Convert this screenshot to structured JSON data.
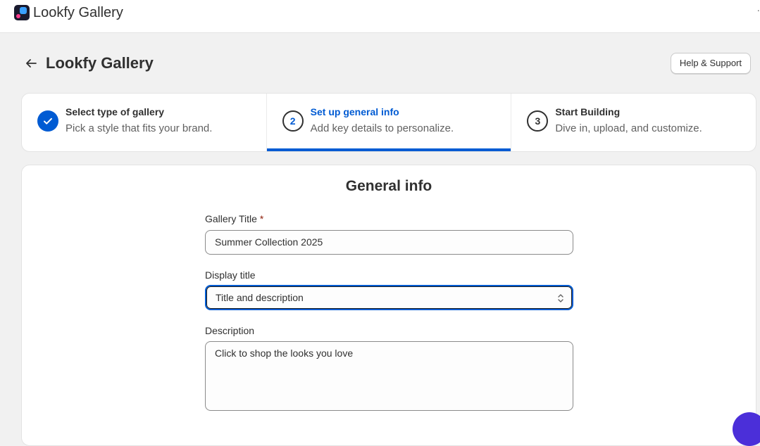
{
  "app": {
    "name": "Lookfy Gallery",
    "more_glyph": "·"
  },
  "header": {
    "title": "Lookfy Gallery",
    "help_label": "Help & Support"
  },
  "steps": [
    {
      "number": "1",
      "title": "Select type of gallery",
      "description": "Pick a style that fits your brand.",
      "status": "done"
    },
    {
      "number": "2",
      "title": "Set up general info",
      "description": "Add key details to personalize.",
      "status": "current"
    },
    {
      "number": "3",
      "title": "Start Building",
      "description": "Dive in, upload, and customize.",
      "status": "todo"
    }
  ],
  "form": {
    "title": "General info",
    "gallery_title": {
      "label": "Gallery Title",
      "required_mark": "*",
      "value": "Summer Collection 2025"
    },
    "display_title": {
      "label": "Display title",
      "value": "Title and description"
    },
    "description": {
      "label": "Description",
      "value": "Click to shop the looks you love"
    }
  },
  "colors": {
    "accent": "#005bd3",
    "required": "#8e1f0b",
    "chat": "#4b2fd9"
  }
}
